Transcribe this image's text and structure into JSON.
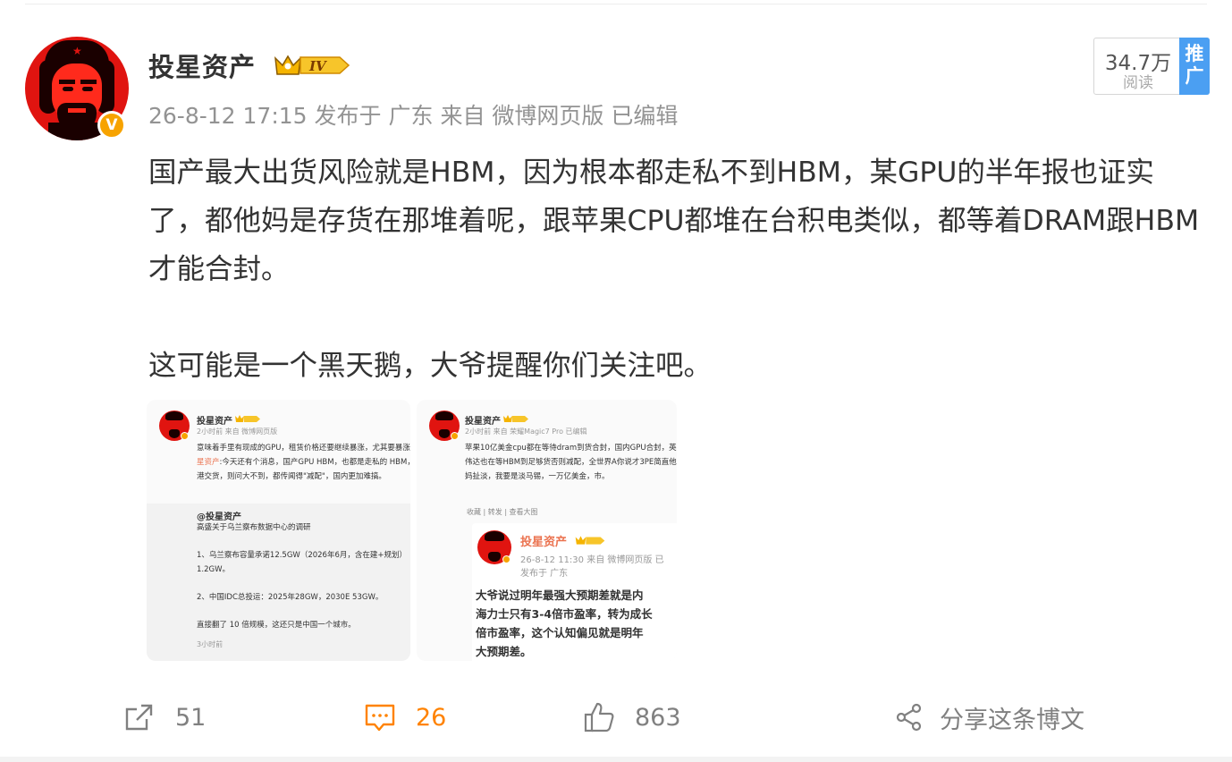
{
  "post": {
    "author": {
      "name": "投星资产",
      "level_badge": "IV",
      "verified_mark": "V"
    },
    "meta": {
      "timestamp": "26-8-12 17:15",
      "location": "发布于 广东",
      "source": "来自 微博网页版",
      "edited": "已编辑"
    },
    "stats": {
      "reads": "34.7万",
      "reads_label": "阅读",
      "promote": "推广"
    },
    "text": {
      "p1": "国产最大出货风险就是HBM，因为根本都走私不到HBM，某GPU的半年报也证实了，都他妈是存货在那堆着呢，跟苹果CPU都堆在台积电类似，都等着DRAM跟HBM才能合封。",
      "p2": "这可能是一个黑天鹅，大爷提醒你们关注吧。"
    },
    "images": [
      {
        "name": "投星资产",
        "meta": "2小时前 来自 微博网页版",
        "text_before_link": "意味着手里有现成的GPU，租赁价格还要继续暴涨，尤其要暴涨翻倍。//",
        "link": "@投星资产",
        "text_after_link": ":今天还有个消息，国产GPU HBM，也都是走私的 HBM，全部都是香港交货，则问大不到，都传闻得\"减配\"，国内更加难搞。",
        "quote_name": "@投星资产",
        "quote_text": "高盛关于乌兰察布数据中心的调研\n\n1、乌兰察布容量承诺12.5GW（2026年6月，含在建+规划）1.2GW。\n\n2、中国IDC总投运：2025年28GW，2030E 53GW。\n\n直接翻了 10 倍规模，这还只是中国一个城市。",
        "quote_time": "3小时前"
      },
      {
        "name": "投星资产",
        "meta": "2小时前 来自 荣耀Magic7 Pro 已编辑",
        "text": "苹果10亿美金cpu都在等待dram到货合封，国内GPU合封，英伟达也在等HBM到足够货否则减配，全世界A你说才3PE简直他妈扯淡，我要是淡马锡，一万亿美金，市。",
        "actions": "收藏  |  转发  |  查看大图",
        "inner_name": "投星资产",
        "inner_meta": "26-8-12 11:30  来自 微博网页版  已",
        "inner_location": "发布于 广东",
        "inner_text": "大爷说过明年最强大预期差就是内\n海力士只有3-4倍市盈率，转为成长\n倍市盈率，这个认知偏见就是明年\n大预期差。"
      }
    ],
    "actions": {
      "forward_count": "51",
      "comment_count": "26",
      "like_count": "863",
      "share_label": "分享这条博文"
    }
  },
  "colors": {
    "accent_orange": "#ff8200",
    "verified_gold": "#f7a300",
    "promote_blue": "#4b9ff2",
    "meta_gray": "#939393"
  }
}
